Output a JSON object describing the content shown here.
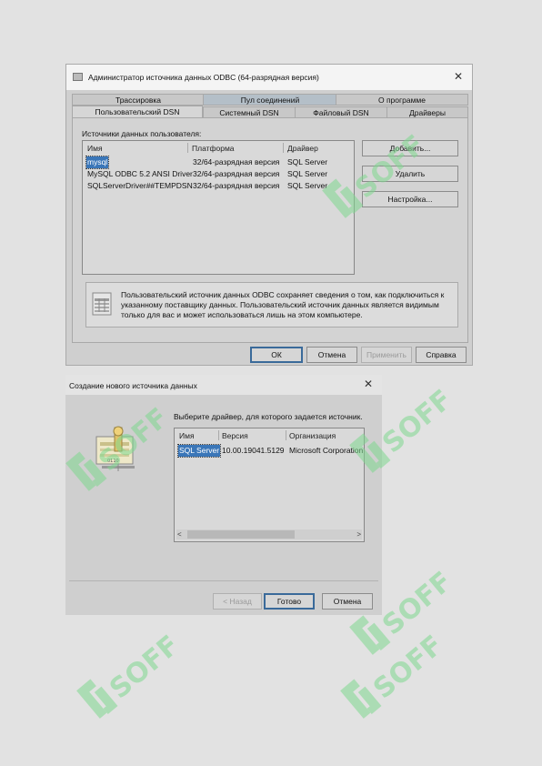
{
  "odbc_admin": {
    "title": "Администратор источника данных ODBC (64-разрядная версия)",
    "tabs_row1": [
      "Трассировка",
      "Пул соединений",
      "О программе"
    ],
    "tabs_row2": [
      "Пользовательский DSN",
      "Системный DSN",
      "Файловый DSN",
      "Драйверы"
    ],
    "section_label": "Источники данных пользователя:",
    "columns": [
      "Имя",
      "Платформа",
      "Драйвер"
    ],
    "rows": [
      {
        "name": "mysql",
        "platform": "32/64-разрядная версия",
        "driver": "SQL Server"
      },
      {
        "name": "MySQL ODBC 5.2 ANSI Driver",
        "platform": "32/64-разрядная версия",
        "driver": "SQL Server"
      },
      {
        "name": "SQLServerDriver##TEMPDSN",
        "platform": "32/64-разрядная версия",
        "driver": "SQL Server"
      }
    ],
    "buttons": {
      "add": "Добавить...",
      "remove": "Удалить",
      "configure": "Настройка..."
    },
    "info": "Пользовательский источник данных ODBC сохраняет сведения о том, как подключиться к указанному поставщику данных.   Пользовательский источник данных является видимым только для вас и может использоваться лишь на этом компьютере.",
    "footer": {
      "ok": "ОК",
      "cancel": "Отмена",
      "apply": "Применить",
      "help": "Справка"
    }
  },
  "create_source": {
    "title": "Создание нового источника данных",
    "prompt": "Выберите драйвер, для которого задается источник.",
    "columns": [
      "Имя",
      "Версия",
      "Организация"
    ],
    "rows": [
      {
        "name": "SQL Server",
        "version": "10.00.19041.5129",
        "org": "Microsoft Corporation"
      }
    ],
    "footer": {
      "back": "< Назад",
      "finish": "Готово",
      "cancel": "Отмена"
    }
  },
  "watermark": "SOFF",
  "colors": {
    "selection": "#3a76b8",
    "watermark": "#7fd88f"
  }
}
